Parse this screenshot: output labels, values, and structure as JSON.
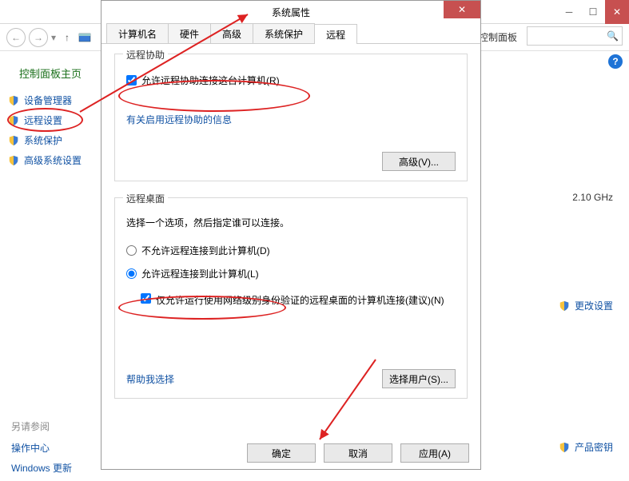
{
  "explorer": {
    "breadcrumb": "控制面板",
    "help_glyph": "?"
  },
  "sidebar": {
    "title": "控制面板主页",
    "items": [
      {
        "label": "设备管理器"
      },
      {
        "label": "远程设置"
      },
      {
        "label": "系统保护"
      },
      {
        "label": "高级系统设置"
      }
    ],
    "see_also_heading": "另请参阅",
    "see_also": [
      {
        "label": "操作中心"
      },
      {
        "label": "Windows 更新"
      }
    ]
  },
  "right": {
    "cpu_speed": "2.10 GHz",
    "change_settings": "更改设置",
    "product_key": "产品密钥"
  },
  "dialog": {
    "title": "系统属性",
    "close_glyph": "✕",
    "tabs": [
      "计算机名",
      "硬件",
      "高级",
      "系统保护",
      "远程"
    ],
    "active_tab": "远程",
    "group1": {
      "legend": "远程协助",
      "checkbox_label": "允许远程协助连接这台计算机(R)",
      "link": "有关启用远程协助的信息",
      "adv_button": "高级(V)..."
    },
    "group2": {
      "legend": "远程桌面",
      "instruction": "选择一个选项，然后指定谁可以连接。",
      "radio1": "不允许远程连接到此计算机(D)",
      "radio2": "允许远程连接到此计算机(L)",
      "sub_checkbox": "仅允许运行使用网络级别身份验证的远程桌面的计算机连接(建议)(N)",
      "help_link": "帮助我选择",
      "select_users": "选择用户(S)..."
    },
    "buttons": {
      "ok": "确定",
      "cancel": "取消",
      "apply": "应用(A)"
    }
  }
}
